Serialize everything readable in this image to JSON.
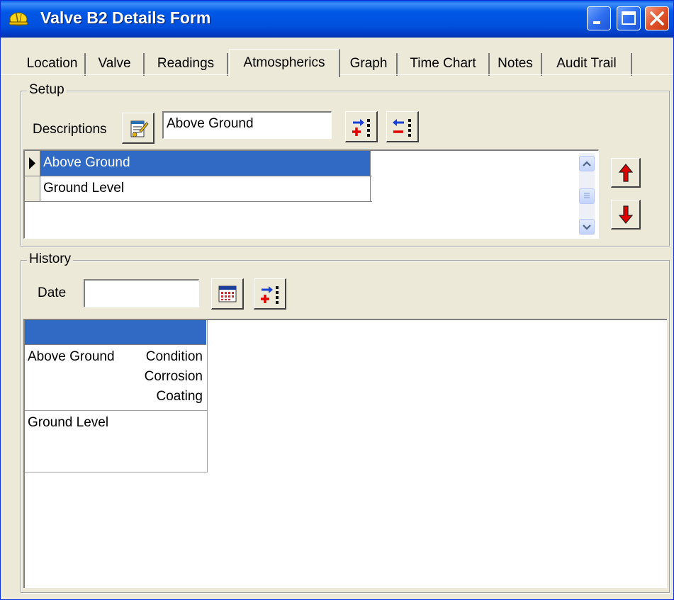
{
  "window": {
    "title": "Valve B2 Details Form"
  },
  "tabs": [
    {
      "label": "Location"
    },
    {
      "label": "Valve"
    },
    {
      "label": "Readings"
    },
    {
      "label": "Atmospherics"
    },
    {
      "label": "Graph"
    },
    {
      "label": "Time Chart"
    },
    {
      "label": "Notes"
    },
    {
      "label": "Audit Trail"
    }
  ],
  "active_tab": "Atmospherics",
  "setup": {
    "legend": "Setup",
    "descriptions_label": "Descriptions",
    "description_value": "Above Ground",
    "list": [
      "Above Ground",
      "Ground Level"
    ],
    "selected_index": 0
  },
  "history": {
    "legend": "History",
    "date_label": "Date",
    "date_value": "",
    "rows": [
      {
        "name": "Above Ground",
        "properties": [
          "Condition",
          "Corrosion",
          "Coating"
        ]
      },
      {
        "name": "Ground Level",
        "properties": []
      }
    ]
  },
  "colors": {
    "titlebar": "#0054E3",
    "selection": "#316AC5",
    "window_face": "#ECE9D8",
    "arrow_red": "#E00000"
  },
  "icons": {
    "app": "hardhat-icon",
    "edit": "notepad-edit-icon",
    "add": "add-item-icon",
    "remove": "remove-item-icon",
    "move_up": "red-up-arrow-icon",
    "move_down": "red-down-arrow-icon",
    "calendar": "calendar-icon"
  }
}
